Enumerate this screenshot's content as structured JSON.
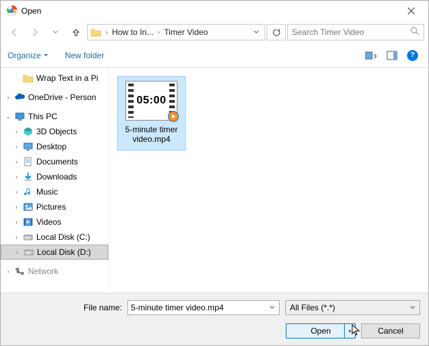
{
  "title": "Open",
  "nav": {
    "back": "←",
    "forward": "→",
    "up": "↑"
  },
  "breadcrumb": [
    "How to In...",
    "Timer Video"
  ],
  "search_placeholder": "Search Timer Video",
  "toolbar": {
    "organize": "Organize",
    "new_folder": "New folder"
  },
  "tree": [
    {
      "label": "Wrap Text in a Pi",
      "indent": 1,
      "icon": "folder",
      "exp": ""
    },
    {
      "spacer": true
    },
    {
      "label": "OneDrive - Person",
      "indent": 0,
      "icon": "onedrive",
      "exp": ">"
    },
    {
      "spacer": true
    },
    {
      "label": "This PC",
      "indent": 0,
      "icon": "pc",
      "exp": "v"
    },
    {
      "label": "3D Objects",
      "indent": 1,
      "icon": "3d",
      "exp": ">"
    },
    {
      "label": "Desktop",
      "indent": 1,
      "icon": "desktop",
      "exp": ">"
    },
    {
      "label": "Documents",
      "indent": 1,
      "icon": "docs",
      "exp": ">"
    },
    {
      "label": "Downloads",
      "indent": 1,
      "icon": "down",
      "exp": ">"
    },
    {
      "label": "Music",
      "indent": 1,
      "icon": "music",
      "exp": ">"
    },
    {
      "label": "Pictures",
      "indent": 1,
      "icon": "pics",
      "exp": ">"
    },
    {
      "label": "Videos",
      "indent": 1,
      "icon": "vids",
      "exp": ">"
    },
    {
      "label": "Local Disk (C:)",
      "indent": 1,
      "icon": "disk",
      "exp": ">"
    },
    {
      "label": "Local Disk (D:)",
      "indent": 1,
      "icon": "disk",
      "exp": ">",
      "selected": true
    },
    {
      "spacer": true
    },
    {
      "label": "Network",
      "indent": 0,
      "icon": "net",
      "exp": ">",
      "faded": true
    }
  ],
  "file": {
    "thumb_text": "05:00",
    "name": "5-minute timer video.mp4"
  },
  "bottom": {
    "filename_label": "File name:",
    "filename_value": "5-minute timer video.mp4",
    "filter": "All Files (*.*)",
    "open": "Open",
    "cancel": "Cancel"
  }
}
